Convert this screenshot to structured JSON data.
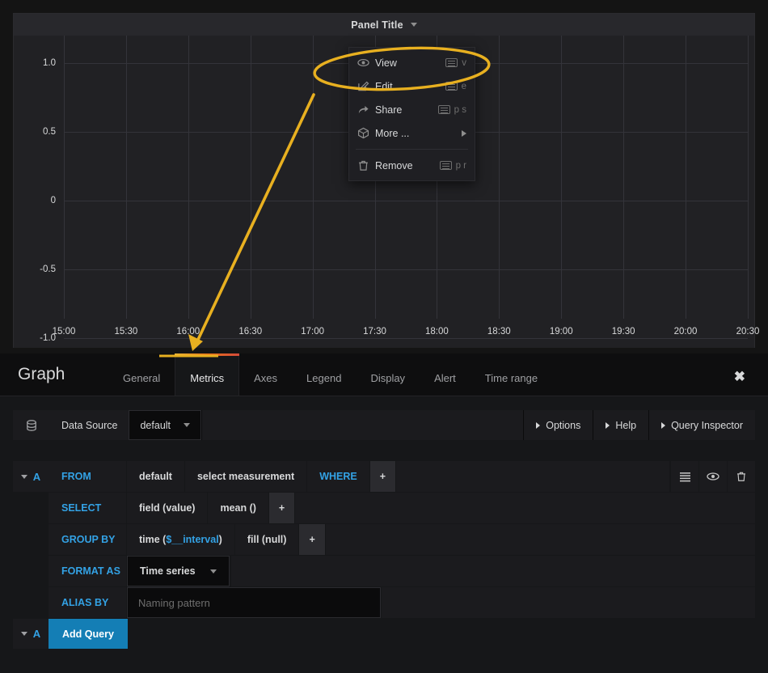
{
  "panel": {
    "title": "Panel Title",
    "menu": [
      {
        "label": "View",
        "icon": "eye-icon",
        "shortcut": "v"
      },
      {
        "label": "Edit",
        "icon": "pencil-square-icon",
        "shortcut": "e"
      },
      {
        "label": "Share",
        "icon": "share-arrow-icon",
        "shortcut": "p s"
      },
      {
        "label": "More ...",
        "icon": "cube-icon",
        "shortcut": ""
      },
      {
        "label": "Remove",
        "icon": "trash-icon",
        "shortcut": "p r"
      }
    ]
  },
  "chart_data": {
    "type": "line",
    "title": "Panel Title",
    "xlabel": "",
    "ylabel": "",
    "series": [],
    "x_ticks": [
      "15:00",
      "15:30",
      "16:00",
      "16:30",
      "17:00",
      "17:30",
      "18:00",
      "18:30",
      "19:00",
      "19:30",
      "20:00",
      "20:30"
    ],
    "y_ticks": [
      "1.0",
      "0.5",
      "0",
      "-0.5",
      "-1.0"
    ],
    "ylim": [
      -1.0,
      1.0
    ],
    "grid": true,
    "legend": "none",
    "annotation": {
      "type": "arrow-and-ellipse",
      "color": "#e8b020",
      "points_to": "Metrics tab"
    }
  },
  "editor": {
    "title": "Graph",
    "tabs": [
      {
        "label": "General",
        "active": false
      },
      {
        "label": "Metrics",
        "active": true
      },
      {
        "label": "Axes",
        "active": false
      },
      {
        "label": "Legend",
        "active": false
      },
      {
        "label": "Display",
        "active": false
      },
      {
        "label": "Alert",
        "active": false
      },
      {
        "label": "Time range",
        "active": false
      }
    ],
    "close_label": "✖",
    "datasource": {
      "label": "Data Source",
      "value": "default",
      "options_label": "Options",
      "help_label": "Help",
      "inspector_label": "Query Inspector"
    },
    "query": {
      "letter": "A",
      "from_label": "FROM",
      "from_policy": "default",
      "from_measurement": "select measurement",
      "where_label": "WHERE",
      "plus": "+",
      "select_label": "SELECT",
      "select_field": "field (value)",
      "select_fn": "mean ()",
      "groupby_label": "GROUP BY",
      "groupby_time_prefix": "time (",
      "groupby_time_var": "$__interval",
      "groupby_time_suffix": ")",
      "groupby_fill": "fill (null)",
      "format_label": "FORMAT AS",
      "format_value": "Time series",
      "alias_label": "ALIAS BY",
      "alias_placeholder": "Naming pattern",
      "add_query_label": "Add Query",
      "add_query_letter": "A"
    }
  },
  "colors": {
    "accent_blue": "#33a2e5",
    "annotation": "#e8b020",
    "panel_bg": "#212124",
    "editor_bg": "#161719"
  }
}
